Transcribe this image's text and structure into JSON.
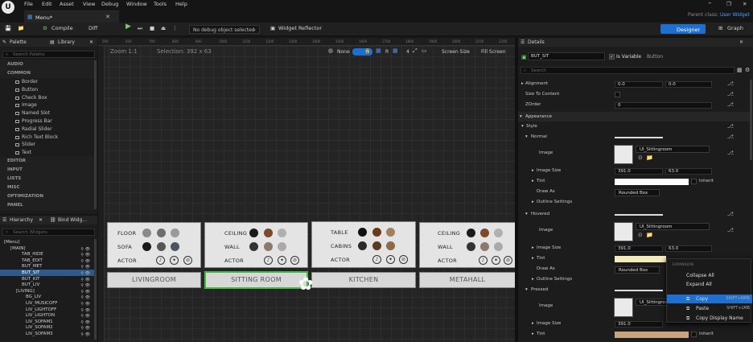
{
  "menubar": {
    "items": [
      "File",
      "Edit",
      "Asset",
      "View",
      "Debug",
      "Window",
      "Tools",
      "Help"
    ]
  },
  "tab": {
    "label": "Menu*"
  },
  "parent_class": {
    "label": "Parent class:",
    "value": "User Widget"
  },
  "toolbar": {
    "compile": "Compile",
    "diff": "Diff",
    "debug_select": "No debug object selected",
    "reflector": "Widget Reflector",
    "designer": "Designer",
    "graph": "Graph"
  },
  "palette": {
    "title": "Palette",
    "library": "Library",
    "search_placeholder": "Search Palette",
    "categories_top": [
      "AUDIO",
      "COMMON"
    ],
    "common_items": [
      "Border",
      "Button",
      "Check Box",
      "Image",
      "Named Slot",
      "Progress Bar",
      "Radial Slider",
      "Rich Text Block",
      "Slider",
      "Text"
    ],
    "categories_bottom": [
      "EDITOR",
      "INPUT",
      "LISTS",
      "MISC",
      "OPTIMIZATION",
      "PANEL"
    ]
  },
  "hierarchy": {
    "title": "Hierarchy",
    "bind": "Bind Widg...",
    "search_placeholder": "Search Widgets",
    "items": [
      "[Menu]",
      "[MAIN]",
      "TAB_HIDE",
      "TAB_EDIT",
      "BUT_MET",
      "BUT_SIT",
      "BUT_KIT",
      "BUT_LIV",
      "[LIVING]",
      "BG_LIV",
      "LIV_MUSICOFF",
      "LIV_LIGHTOFF",
      "LIV_LIGHTON",
      "LIV_SOFAM1",
      "LIV_SOFAM2",
      "LIV_SOFAM3"
    ],
    "selected": "BUT_SIT"
  },
  "canvas": {
    "zoom": "Zoom 1:1",
    "selection": "Selection: 392 x 63",
    "none_label": "None",
    "r_label": "R",
    "four_label": "4",
    "screen_size": "Screen Size",
    "fill_screen": "Fill Screen",
    "ruler_ticks": [
      "500",
      "600",
      "700",
      "800",
      "900",
      "1000",
      "1100",
      "1200",
      "1300",
      "1400",
      "1500",
      "1600",
      "1700",
      "1800",
      "1900",
      "2000",
      "2100",
      "2200"
    ]
  },
  "cards": [
    {
      "rows": [
        "FLOOR",
        "SOFA",
        "ACTOR"
      ]
    },
    {
      "rows": [
        "CEILING",
        "WALL",
        "ACTOR"
      ]
    },
    {
      "rows": [
        "TABLE",
        "CABINS",
        "ACTOR"
      ]
    },
    {
      "rows": [
        "CEILING",
        "WALL",
        "ACTOR"
      ]
    }
  ],
  "room_buttons": [
    "LIVINGROOM",
    "SITTING ROOM",
    "KITCHEN",
    "METAHALL"
  ],
  "details": {
    "title": "Details",
    "name": "BUT_SIT",
    "is_variable": "Is Variable",
    "button_type": "Button",
    "search_placeholder": "Search",
    "alignment": "Alignment",
    "align_x": "0.0",
    "align_y": "0.0",
    "size_to_content": "Size To Content",
    "zorder": "ZOrder",
    "zorder_val": "0",
    "appearance": "Appearance",
    "style": "Style",
    "normal": "Normal",
    "hovered": "Hovered",
    "pressed": "Pressed",
    "image": "Image",
    "image_name": "UI_Sittingroom",
    "image_size": "Image Size",
    "size_x": "391.0",
    "size_y": "63.0",
    "tint": "Tint",
    "inherit": "Inherit",
    "draw_as": "Draw As",
    "draw_as_val": "Rounded Box",
    "outline": "Outline Settings"
  },
  "context_menu": {
    "header": "EXPANSION",
    "collapse": "Collapse All",
    "expand": "Expand All",
    "copy": "Copy",
    "copy_sc": "SHIFT+RMB",
    "paste": "Paste",
    "paste_sc": "SHIFT+LMB",
    "copy_display": "Copy Display Name"
  },
  "colors": {
    "accent": "#1f6fd1",
    "selection": "#2d5a8a",
    "green_outline": "#3cbf3c"
  }
}
